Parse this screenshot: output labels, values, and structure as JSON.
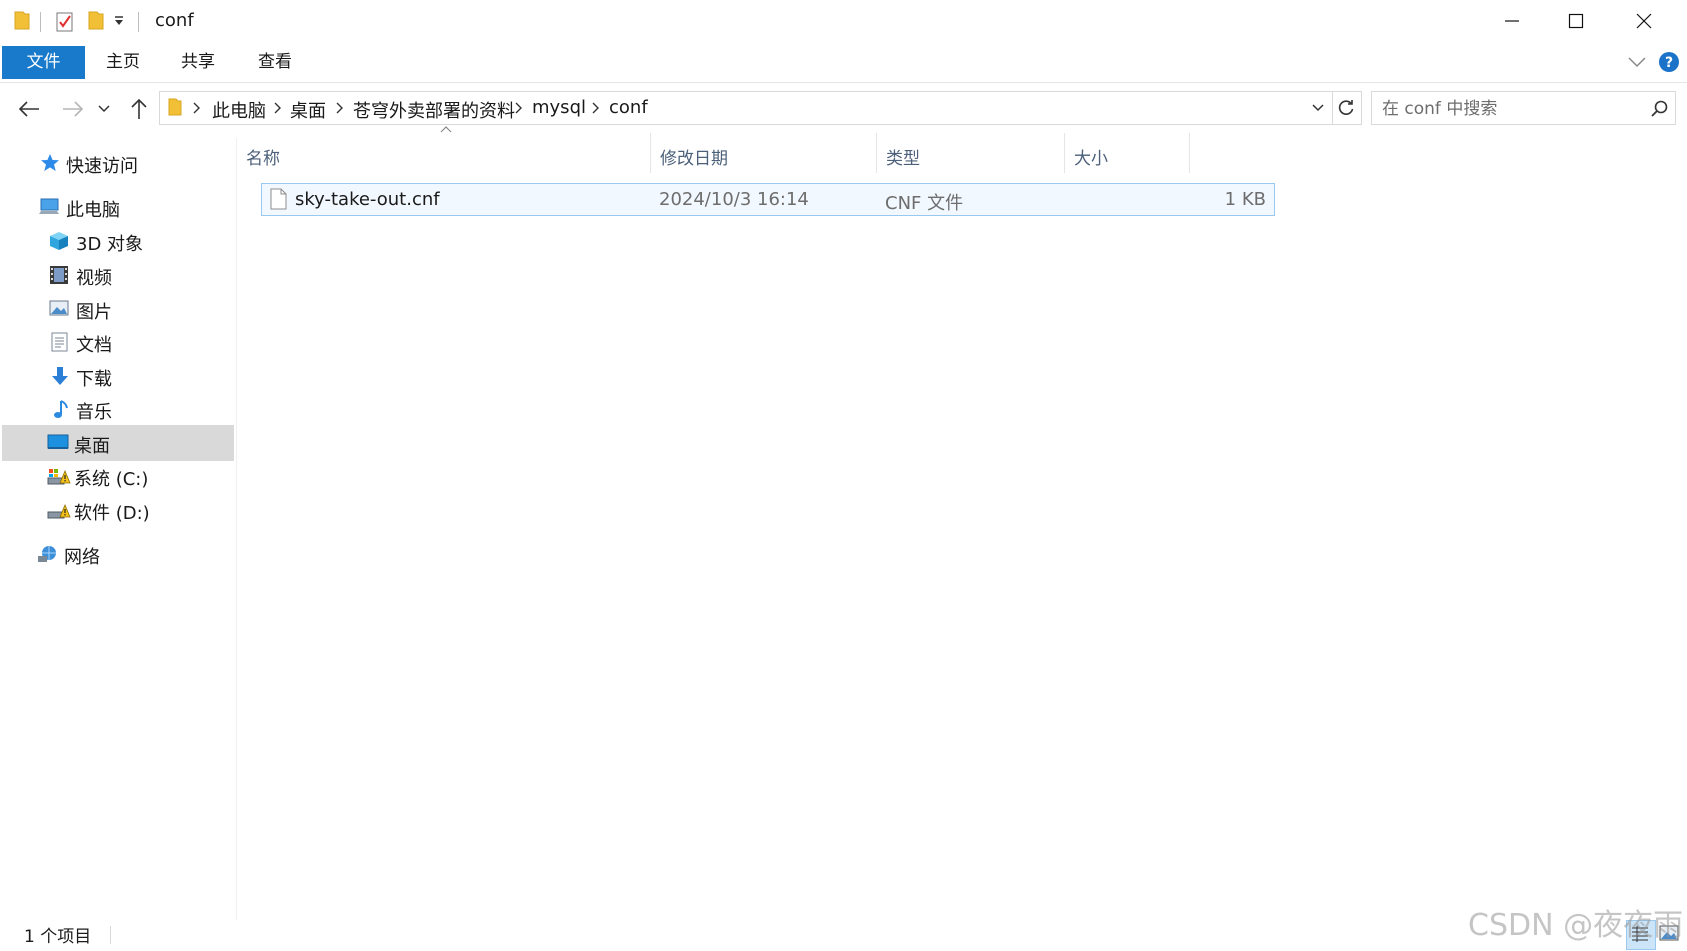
{
  "window": {
    "title": "conf"
  },
  "ribbon": {
    "tabs": [
      {
        "label": "文件",
        "active": true
      },
      {
        "label": "主页"
      },
      {
        "label": "共享"
      },
      {
        "label": "查看"
      }
    ]
  },
  "address": {
    "path": [
      "此电脑",
      "桌面",
      "苍穹外卖部署的资料",
      "mysql",
      "conf"
    ],
    "search_placeholder": "在 conf 中搜索"
  },
  "sidebar": {
    "items": [
      {
        "label": "快速访问",
        "icon": "star-icon"
      },
      {
        "label": "此电脑",
        "icon": "computer-icon"
      },
      {
        "label": "3D 对象",
        "icon": "cube-icon"
      },
      {
        "label": "视频",
        "icon": "video-icon"
      },
      {
        "label": "图片",
        "icon": "picture-icon"
      },
      {
        "label": "文档",
        "icon": "document-icon"
      },
      {
        "label": "下载",
        "icon": "download-icon"
      },
      {
        "label": "音乐",
        "icon": "music-icon"
      },
      {
        "label": "桌面",
        "icon": "desktop-icon",
        "selected": true
      },
      {
        "label": "系统 (C:)",
        "icon": "drive-icon"
      },
      {
        "label": "软件 (D:)",
        "icon": "drive-icon"
      },
      {
        "label": "网络",
        "icon": "network-icon"
      }
    ]
  },
  "list": {
    "columns": [
      "名称",
      "修改日期",
      "类型",
      "大小"
    ],
    "rows": [
      {
        "name": "sky-take-out.cnf",
        "modified": "2024/10/3 16:14",
        "type": "CNF 文件",
        "size": "1 KB"
      }
    ]
  },
  "status": {
    "count": "1 个项目"
  },
  "watermark": "CSDN @夜夜雨",
  "colors": {
    "accent": "#1979ca",
    "selection_bg": "#f2f8ff",
    "selection_border": "#99c9ef",
    "nav_selected": "#d9d9d9"
  }
}
